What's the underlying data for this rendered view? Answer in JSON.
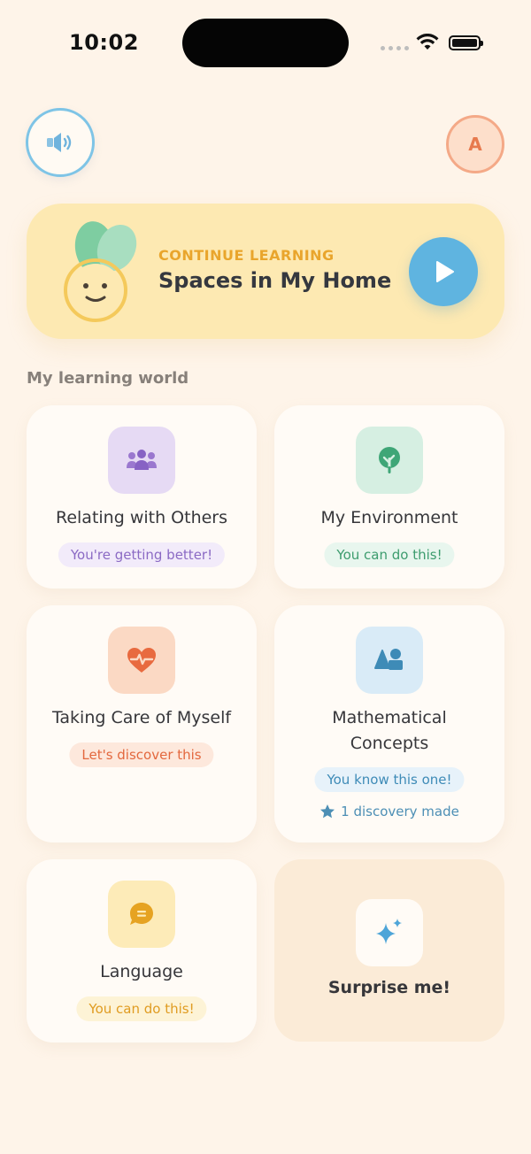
{
  "status_bar": {
    "time": "10:02"
  },
  "header": {
    "avatar_letter": "A"
  },
  "continue": {
    "label": "CONTINUE LEARNING",
    "title": "Spaces in My Home"
  },
  "section_title": "My learning world",
  "cards": [
    {
      "title": "Relating with Others",
      "status": "You're getting better!",
      "icon": "people-icon",
      "tile_color": "#E6DAF4",
      "pill_bg": "#F2EBFA",
      "pill_color": "#8B6AC4"
    },
    {
      "title": "My Environment",
      "status": "You can do this!",
      "icon": "tree-icon",
      "tile_color": "#D6EFE2",
      "pill_bg": "#E8F6EE",
      "pill_color": "#3D9C6E"
    },
    {
      "title": "Taking Care of Myself",
      "status": "Let's discover this",
      "icon": "heart-pulse-icon",
      "tile_color": "#FBD9C4",
      "pill_bg": "#FDE8DC",
      "pill_color": "#E3683E"
    },
    {
      "title_line1": "Mathematical",
      "title_line2": "Concepts",
      "status": "You know this one!",
      "discovery": "1 discovery made",
      "icon": "shapes-icon",
      "tile_color": "#D9EBF7",
      "pill_bg": "#E7F2FA",
      "pill_color": "#3E8BB7"
    },
    {
      "title": "Language",
      "status": "You can do this!",
      "icon": "chat-bubble-icon",
      "tile_color": "#FDEBB8",
      "pill_bg": "#FDF3D6",
      "pill_color": "#E09C22"
    }
  ],
  "surprise": {
    "label": "Surprise me!"
  }
}
